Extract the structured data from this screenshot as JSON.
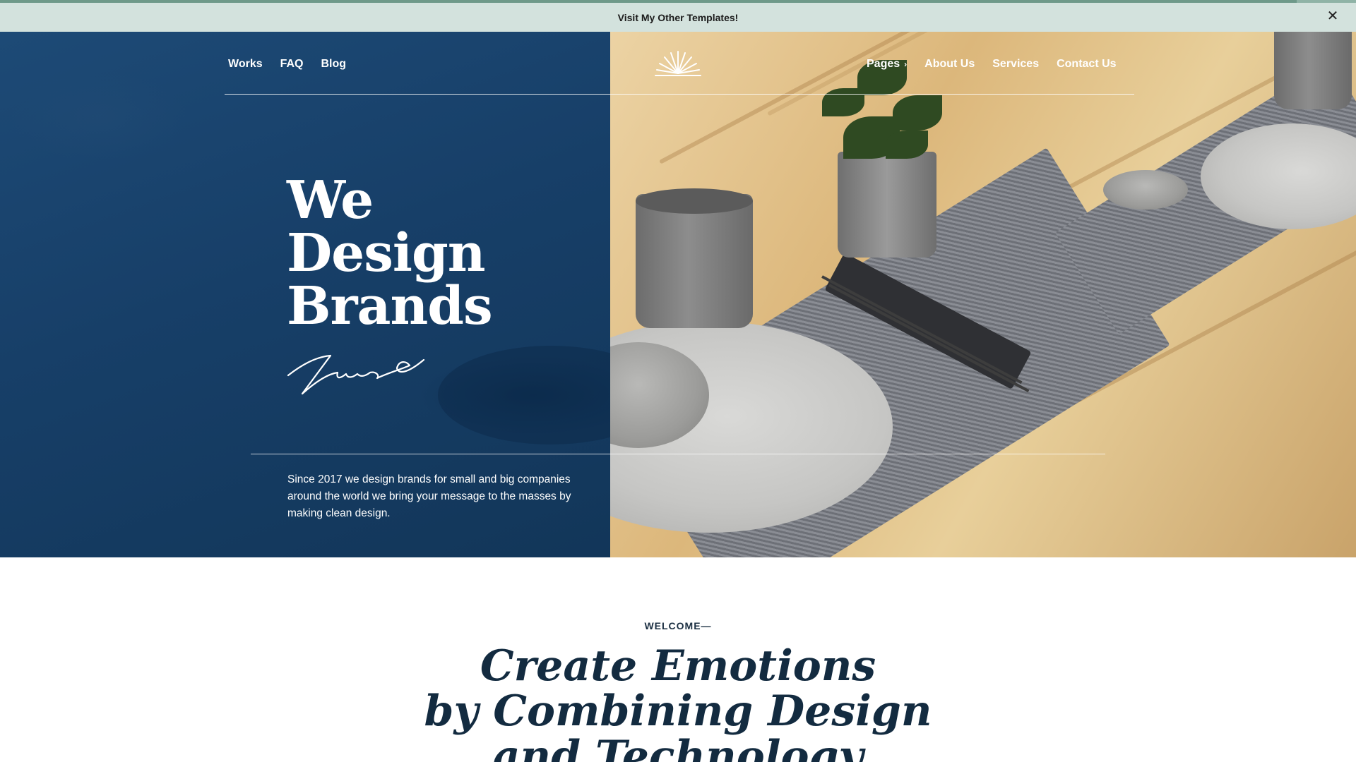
{
  "announcement": {
    "link_text": "Visit My Other Templates!",
    "close_icon": "close-icon",
    "progress_percent": 95.6
  },
  "nav": {
    "left_items": [
      {
        "label": "Works"
      },
      {
        "label": "FAQ"
      },
      {
        "label": "Blog"
      }
    ],
    "logo_icon": "sunburst-logo-icon",
    "right_items": [
      {
        "label": "Pages",
        "icon": "chevron-down-icon"
      },
      {
        "label": "About Us"
      },
      {
        "label": "Services"
      },
      {
        "label": "Contact Us"
      }
    ]
  },
  "hero": {
    "headline_lines": [
      "We",
      "Design",
      "Brands"
    ],
    "signature_icon": "signature-icon",
    "intro": "Since 2017 we design brands for small and big companies around the world we bring your message to the masses by making clean design."
  },
  "welcome": {
    "eyebrow": "WELCOME—",
    "title_lines": [
      "Create Emotions",
      "by Combining Design",
      "and Technology"
    ]
  },
  "colors": {
    "announcement_bg": "#d3e2dd",
    "hero_blue": "#173f68",
    "heading_navy": "#132b40",
    "text_white": "#ffffff"
  }
}
